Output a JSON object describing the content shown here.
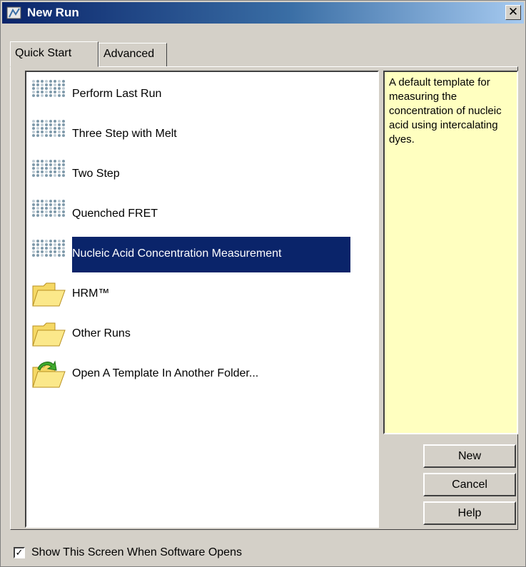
{
  "window": {
    "title": "New Run",
    "close_symbol": "✕"
  },
  "tabs": [
    {
      "label": "Quick Start",
      "active": true
    },
    {
      "label": "Advanced",
      "active": false
    }
  ],
  "templates": [
    {
      "label": "Perform Last Run",
      "icon": "qiagen-dots-icon"
    },
    {
      "label": "Three Step with Melt",
      "icon": "qiagen-dots-icon"
    },
    {
      "label": "Two Step",
      "icon": "qiagen-dots-icon"
    },
    {
      "label": "Quenched FRET",
      "icon": "qiagen-dots-icon"
    },
    {
      "label": "Nucleic Acid Concentration Measurement",
      "icon": "qiagen-dots-icon",
      "selected": true
    },
    {
      "label": "HRM™",
      "icon": "folder-icon"
    },
    {
      "label": "Other Runs",
      "icon": "folder-icon"
    },
    {
      "label": "Open A Template In Another Folder...",
      "icon": "open-folder-icon"
    }
  ],
  "description": "A default template for measuring the concentration of nucleic acid using intercalating dyes.",
  "buttons": {
    "new": "New",
    "cancel": "Cancel",
    "help": "Help"
  },
  "footer": {
    "show_screen_label": "Show This Screen When Software Opens",
    "checked": true
  },
  "colors": {
    "selection": "#0a246a",
    "description_bg": "#ffffc0",
    "titlebar": "#0a246a"
  }
}
